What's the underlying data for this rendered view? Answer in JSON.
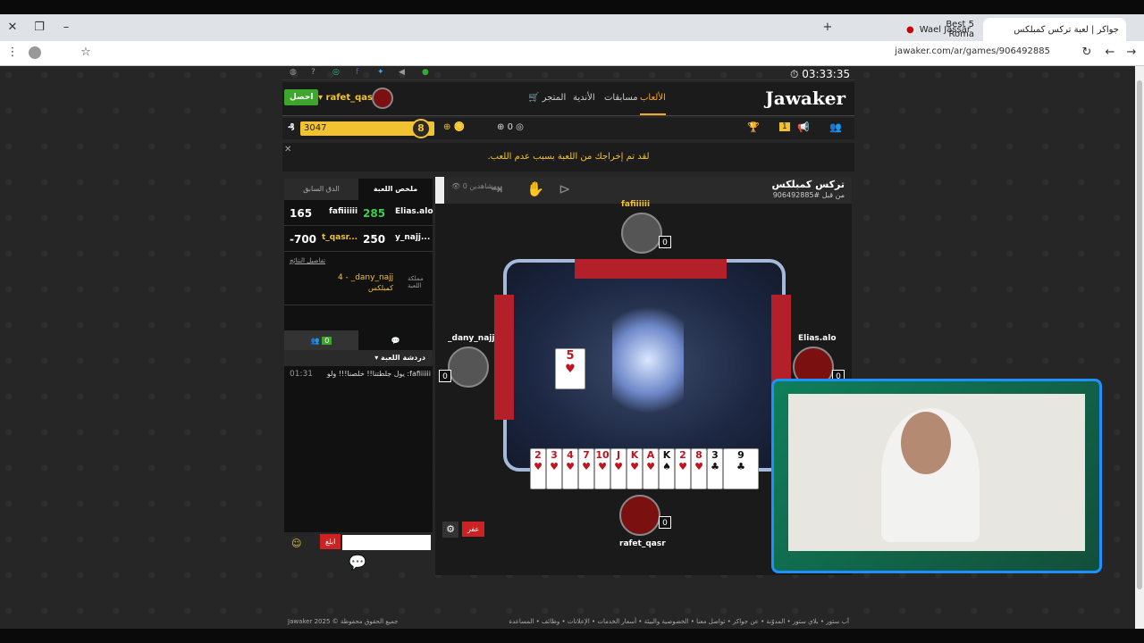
{
  "browser": {
    "tabs": [
      {
        "title": "جواكر | لعبة تركس كمبلكس",
        "active": true
      },
      {
        "title": "Best 5 Roma",
        "active": false
      },
      {
        "title": "Wael Jassar",
        "active": false
      }
    ],
    "url": "jawaker.com/ar/games/906492885",
    "clock": "03:33:35"
  },
  "site": {
    "logo": "Jawaker",
    "nav": [
      {
        "label": "الألعاب",
        "active": true
      },
      {
        "label": "مسابقات"
      },
      {
        "label": "الأندية"
      },
      {
        "label": "المتجر"
      }
    ],
    "user": "rafet_qasr",
    "get_label": "احصل",
    "xp": "3047",
    "level": "8",
    "coins": "0",
    "notice": "لقد تم إخراجك من اللعبة بسبب عدم اللعب.",
    "bell_count": "1"
  },
  "panel": {
    "tabs": [
      "ملخص اللعبة",
      "الدق السابق"
    ],
    "scores": [
      {
        "left_val": "165",
        "left_name": "fafiiiiii",
        "right_val": "285",
        "right_name": "Elias.alo"
      },
      {
        "left_val": "-700",
        "left_name": "t_qasr...",
        "right_val": "250",
        "right_name": "y_najj..."
      }
    ],
    "details_link": "تفاصيل النتائج",
    "kingdom_label": "مملكة اللعبة",
    "kingdom_value": "4 - _dany_najj",
    "kingdom_sub": "كمبلكس",
    "online_count": "0",
    "chat_title": "دردشة اللعبة",
    "chat_msg": "fafiiiiii: يول جلطتنا!! خلصنا!!! ولو",
    "chat_time": "01:31",
    "send_label": "ابلغ"
  },
  "game": {
    "title": "تركس كمبلكس",
    "id": "#906492885",
    "from": "من قبل",
    "spectate": "0 مشاهدين",
    "players": {
      "top": {
        "name": "fafiiiiii",
        "count": "0"
      },
      "left": {
        "name": "_dany_najj",
        "count": "0"
      },
      "right": {
        "name": "Elias.alo",
        "count": "0"
      },
      "bottom": {
        "name": "rafet_qasr",
        "count": "0"
      }
    },
    "center_card": "5",
    "hand": [
      "2",
      "3",
      "4",
      "7",
      "10",
      "J",
      "K",
      "A",
      "K",
      "2",
      "8",
      "3",
      "9"
    ],
    "sorry_label": "عفر"
  },
  "footer": {
    "copyright": "Jawaker 2025 © جميع الحقوق محفوظة",
    "links": "آب ستور • بلاي ستور • المدوّنة • عن جواكر • تواصل معنا • الخصوصية والبيئة • أسعار الخدمات • الإعلانات • وظائف • المساعدة"
  }
}
